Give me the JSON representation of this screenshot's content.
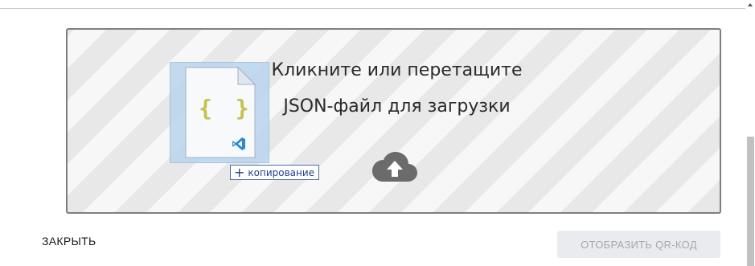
{
  "dropzone": {
    "line1": "Кликните или перетащите",
    "line2": "JSON-файл для загрузки",
    "upload_icon": "cloud-upload-icon"
  },
  "drag_ghost": {
    "file_icon": "json-file-icon",
    "braces": "{ }",
    "app_icon": "vscode-icon",
    "copy_badge": "копирование",
    "copy_icon": "plus-icon"
  },
  "footer": {
    "close_label": "ЗАКРЫТЬ",
    "qr_label": "ОТОБРАЗИТЬ QR-КОД",
    "qr_disabled": true
  },
  "colors": {
    "dropzone_border": "#7f7f7f",
    "stripe_dark": "#e8e8e8",
    "stripe_light": "#f7f7f7",
    "upload_icon": "#6b6b6b",
    "disabled_button_bg": "#e9ebee",
    "disabled_button_text": "#a4a9b0"
  }
}
